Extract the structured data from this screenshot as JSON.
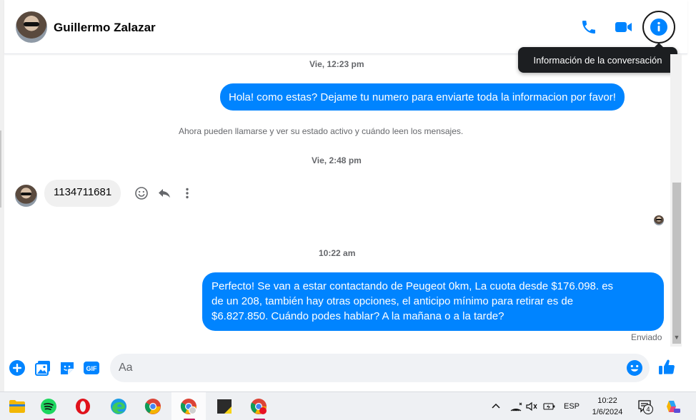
{
  "header": {
    "contact_name": "Guillermo Zalazar",
    "tooltip": "Información de la conversación"
  },
  "messages": {
    "ts1": "Vie, 12:23 pm",
    "out1": "Hola! como estas? Dejame tu numero para enviarte toda la informacion por favor!",
    "system": "Ahora pueden llamarse y ver su estado activo y cuándo leen los mensajes.",
    "ts2": "Vie, 2:48 pm",
    "in1": "1134711681",
    "ts3": "10:22 am",
    "out2_line1": "Perfecto!  Se van a estar contactando de Peugeot 0km, La cuota desde $176.098. es",
    "out2_line2": "de un 208, también hay otras opciones, el anticipo mínimo para retirar es de",
    "out2_line3": "$6.827.850. Cuándo podes hablar? A la mañana o a la tarde?",
    "status": "Enviado"
  },
  "composer": {
    "placeholder": "Aa"
  },
  "taskbar": {
    "language": "ESP",
    "time": "10:22",
    "date": "1/6/2024",
    "notifications": "4"
  },
  "colors": {
    "accent": "#0084ff",
    "incoming": "#f0f0f0",
    "tooltip_bg": "#1c1e21"
  }
}
